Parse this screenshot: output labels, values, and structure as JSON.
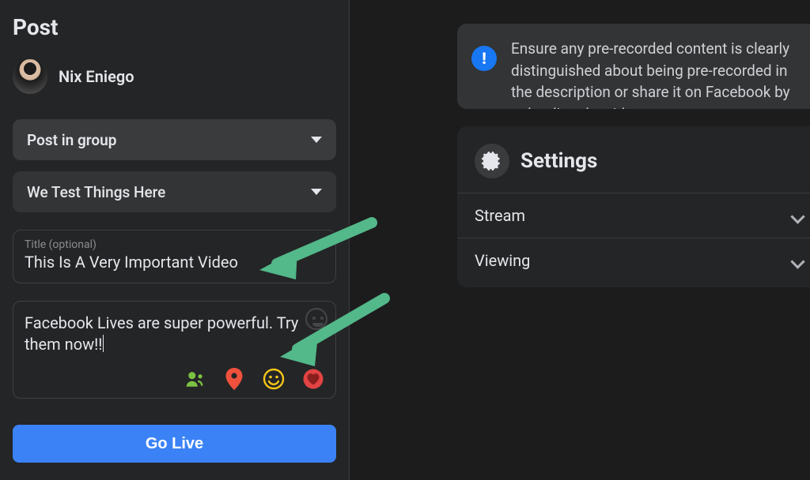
{
  "left": {
    "heading": "Post",
    "user_name": "Nix Eniego",
    "audience_selector": "Post in group",
    "group_selector": "We Test Things Here",
    "title_label": "Title (optional)",
    "title_value": "This Is A Very Important Video",
    "description_value": "Facebook Lives are super powerful. Try them now!!",
    "go_live_label": "Go Live",
    "attach_icons": [
      "tag-people-icon",
      "location-icon",
      "feeling-icon",
      "raise-money-icon"
    ]
  },
  "right": {
    "banner_text": "Ensure any pre-recorded content is clearly distinguished about being pre-recorded in the description or share it on Facebook by uploading the video as a post on",
    "settings_title": "Settings",
    "settings_rows": [
      "Stream",
      "Viewing"
    ]
  },
  "colors": {
    "accent": "#3b82f6",
    "info": "#1877f2",
    "arrow": "#53b88a"
  }
}
